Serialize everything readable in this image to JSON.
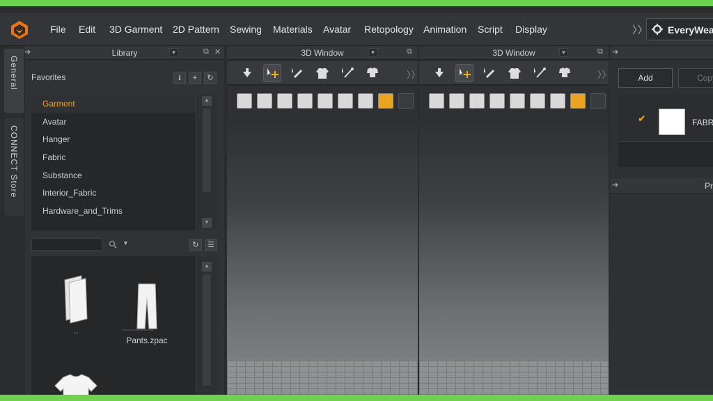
{
  "menubar": {
    "items": [
      "File",
      "Edit",
      "3D Garment",
      "2D Pattern",
      "Sewing",
      "Materials",
      "Avatar",
      "Retopology",
      "Animation",
      "Script",
      "Display"
    ],
    "overflow": "〉〉",
    "brand": "EveryWear"
  },
  "sidetabs": {
    "general": "General",
    "store": "CONNECT Store"
  },
  "library": {
    "title": "Library",
    "favorites_label": "Favorites",
    "favorites": [
      "Garment",
      "Avatar",
      "Hanger",
      "Fabric",
      "Substance",
      "Interior_Fabric",
      "Hardware_and_Trims"
    ],
    "selected_index": 0,
    "search_placeholder": "",
    "files": [
      {
        "label": "..",
        "icon": "folder-icon"
      },
      {
        "label": "Pants.zpac",
        "icon": "pants-icon"
      },
      {
        "label": "",
        "icon": "tshirt-icon"
      }
    ]
  },
  "views": [
    {
      "title": "3D Window"
    },
    {
      "title": "3D Window"
    }
  ],
  "right_panel": {
    "add_label": "Add",
    "copy_label": "Copy",
    "fabric_name": "FABRIC",
    "property_title": "Property Editor"
  },
  "colors": {
    "accent_orange": "#f2b10a",
    "frame_green": "#6ed24e",
    "selected_text": "#f0a020"
  }
}
